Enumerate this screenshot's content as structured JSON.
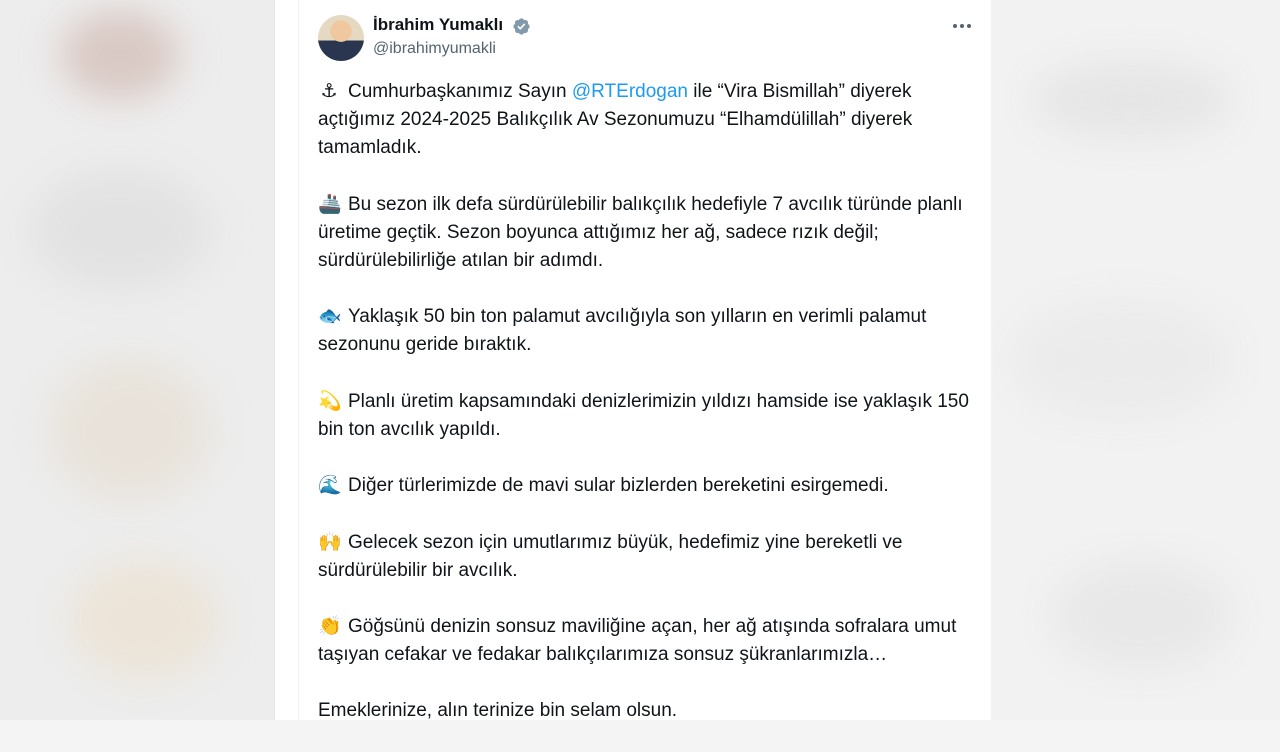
{
  "author": {
    "name": "İbrahim Yumaklı",
    "handle": "@ibrahimyumakli"
  },
  "icons": {
    "verified": "verified-badge-icon",
    "more": "more-options-icon"
  },
  "colors": {
    "mention": "#1d9bf0",
    "verified": "#829aab",
    "text": "#0f1419",
    "muted": "#536471"
  },
  "tweet": {
    "p1_emoji": "⚓",
    "p1_before": "Cumhurbaşkanımız Sayın ",
    "p1_mention": "@RTErdogan",
    "p1_after": " ile “Vira Bismillah” diyerek açtığımız 2024-2025 Balıkçılık Av Sezonumuzu “Elhamdülillah” diyerek tamamladık.",
    "p2_emoji": "🚢",
    "p2": "Bu sezon ilk defa sürdürülebilir balıkçılık hedefiyle 7 avcılık türünde planlı üretime geçtik. Sezon boyunca attığımız her ağ, sadece rızık değil; sürdürülebilirliğe atılan bir adımdı.",
    "p3_emoji": "🐟",
    "p3": "Yaklaşık 50 bin ton palamut avcılığıyla son yılların en verimli palamut sezonunu geride bıraktık.",
    "p4_emoji": "💫",
    "p4": "Planlı üretim kapsamındaki denizlerimizin yıldızı hamside ise yaklaşık 150 bin ton avcılık yapıldı.",
    "p5_emoji": "🌊",
    "p5": "Diğer türlerimizde de mavi sular bizlerden bereketini esirgemedi.",
    "p6_emoji": "🙌",
    "p6": "Gelecek sezon için umutlarımız büyük, hedefimiz yine bereketli ve sürdürülebilir bir avcılık.",
    "p7_emoji": "👏",
    "p7": "Göğsünü denizin sonsuz maviliğine açan, her ağ atışında sofralara umut taşıyan cefakar ve fedakar balıkçılarımıza sonsuz şükranlarımızla…",
    "p8": "Emeklerinize, alın terinize bin selam olsun."
  }
}
